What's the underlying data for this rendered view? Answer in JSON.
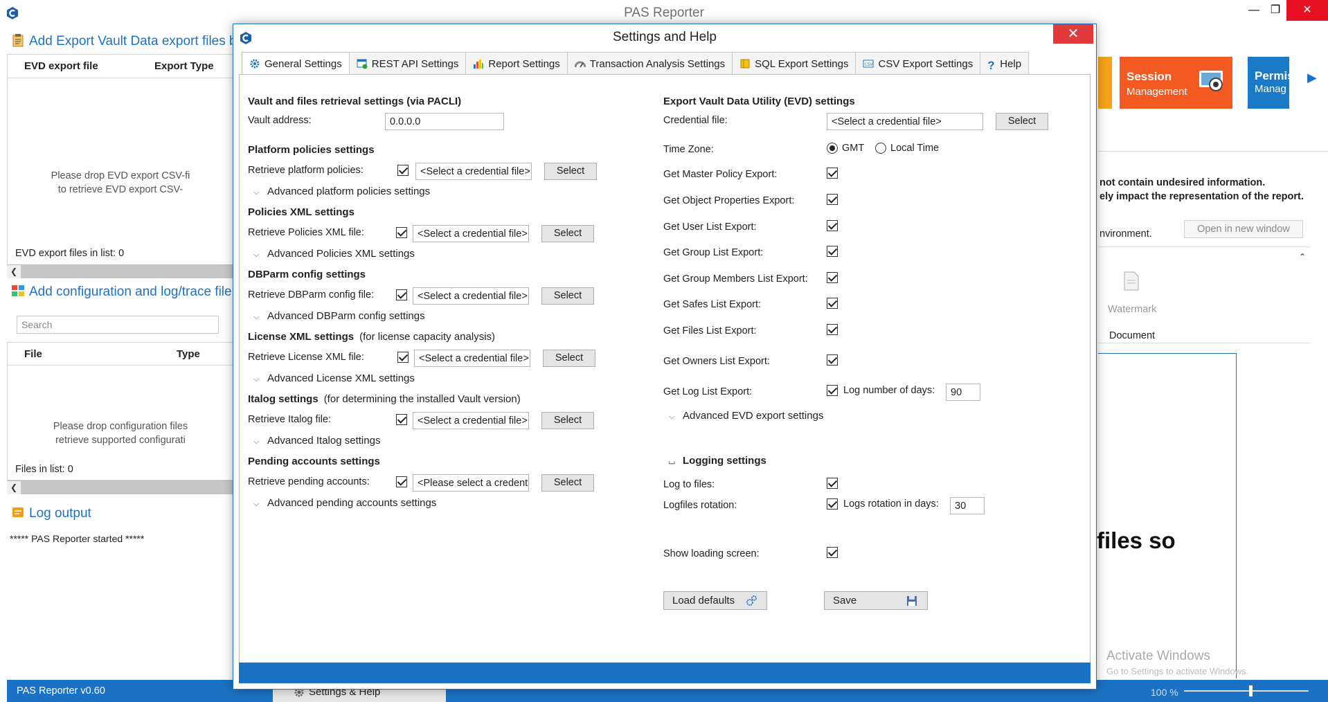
{
  "main_window": {
    "title": "PAS Reporter",
    "evd_section": {
      "title": "Add Export Vault Data export files b",
      "columns": [
        "EVD export file",
        "Export Type"
      ],
      "drop_message": "Please drop EVD export CSV-fi\nto retrieve EVD export CSV-",
      "count": "EVD export files in list: 0"
    },
    "config_section": {
      "title": "Add configuration and log/trace file",
      "search_placeholder": "Search",
      "columns": [
        "File",
        "Type"
      ],
      "drop_message": "Please drop configuration files\nretrieve supported configurati",
      "count": "Files in list: 0"
    },
    "log_section": {
      "title": "Log output",
      "text": "***** PAS Reporter started *****"
    },
    "tiles": {
      "session_title": "Session",
      "session_sub": "Management",
      "perm_title": "Permis",
      "perm_sub": "Manag"
    },
    "behind": {
      "line1": "not contain undesired information.",
      "line2": "ely impact the representation of the report.",
      "line3": "nvironment.",
      "open_new_window": "Open in new window",
      "watermark": "Watermark",
      "document": "Document",
      "big_text": "files so",
      "activate1": "Activate Windows",
      "activate2": "Go to Settings to activate Windows."
    },
    "status": {
      "version": "PAS Reporter v0.60",
      "tab_label": "Settings & Help",
      "zoom": "100 %"
    }
  },
  "dialog": {
    "title": "Settings and Help",
    "tabs": [
      {
        "label": "General Settings",
        "icon": "gear-icon"
      },
      {
        "label": "REST API Settings",
        "icon": "api-icon"
      },
      {
        "label": "Report Settings",
        "icon": "bar-chart-icon"
      },
      {
        "label": "Transaction Analysis Settings",
        "icon": "gauge-icon"
      },
      {
        "label": "SQL Export Settings",
        "icon": "database-icon"
      },
      {
        "label": "CSV Export Settings",
        "icon": "csv-icon"
      },
      {
        "label": "Help",
        "icon": "help-icon"
      }
    ],
    "left": {
      "vault_heading": "Vault and files retrieval settings (via PACLI)",
      "vault_address_label": "Vault address:",
      "vault_address_value": "0.0.0.0",
      "platform_heading": "Platform policies settings",
      "platform_label": "Retrieve platform policies:",
      "platform_file": "<Select a credential file>",
      "platform_adv": "Advanced platform policies settings",
      "policies_heading": "Policies XML settings",
      "policies_label": "Retrieve Policies XML file:",
      "policies_file": "<Select a credential file>",
      "policies_adv": "Advanced Policies XML settings",
      "dbparm_heading": "DBParm config settings",
      "dbparm_label": "Retrieve DBParm config file:",
      "dbparm_file": "<Select a credential file>",
      "dbparm_adv": "Advanced DBParm config settings",
      "license_heading": "License XML settings",
      "license_note": "(for license capacity analysis)",
      "license_label": "Retrieve License XML file:",
      "license_file": "<Select a credential file>",
      "license_adv": "Advanced License XML settings",
      "italog_heading": "Italog settings",
      "italog_note": "(for determining the installed Vault version)",
      "italog_label": "Retrieve Italog file:",
      "italog_file": "<Select a credential file>",
      "italog_adv": "Advanced Italog settings",
      "pending_heading": "Pending accounts settings",
      "pending_label": "Retrieve pending accounts:",
      "pending_file": "<Please select a credential file>",
      "pending_adv": "Advanced pending accounts settings",
      "select_label": "Select"
    },
    "right": {
      "evd_heading": "Export Vault Data Utility (EVD) settings",
      "credential_label": "Credential file:",
      "credential_value": "<Select a credential file>",
      "select_label": "Select",
      "timezone_label": "Time Zone:",
      "tz_gmt": "GMT",
      "tz_local": "Local Time",
      "exports": [
        "Get Master Policy Export:",
        "Get Object Properties Export:",
        "Get User List Export:",
        "Get Group List Export:",
        "Get Group Members List Export:",
        "Get Safes List Export:",
        "Get Files List Export:",
        "Get Owners List Export:",
        "Get Log List Export:"
      ],
      "log_days_label": "Log number of days:",
      "log_days_value": "90",
      "evd_adv": "Advanced EVD export settings",
      "logging_heading": "Logging settings",
      "log_to_files": "Log to files:",
      "logfiles_rotation": "Logfiles rotation:",
      "rotation_days_label": "Logs rotation in days:",
      "rotation_days_value": "30",
      "show_loading": "Show loading screen:",
      "load_defaults": "Load defaults",
      "save": "Save"
    }
  }
}
